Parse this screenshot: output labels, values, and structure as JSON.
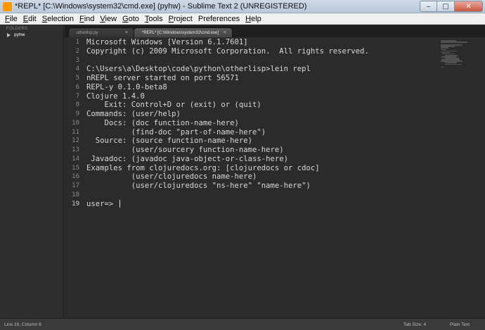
{
  "window": {
    "title": "*REPL* [C:\\Windows\\system32\\cmd.exe] (pyhw) - Sublime Text 2 (UNREGISTERED)",
    "minimize_glyph": "‒",
    "maximize_glyph": "□",
    "close_glyph": "✕"
  },
  "menu": [
    {
      "accel": "F",
      "rest": "ile"
    },
    {
      "accel": "E",
      "rest": "dit"
    },
    {
      "accel": "S",
      "rest": "election"
    },
    {
      "accel": "F",
      "rest": "ind"
    },
    {
      "accel": "V",
      "rest": "iew"
    },
    {
      "accel": "G",
      "rest": "oto"
    },
    {
      "accel": "T",
      "rest": "ools"
    },
    {
      "accel": "P",
      "rest": "roject"
    },
    {
      "accel": "",
      "rest": "Preferences"
    },
    {
      "accel": "H",
      "rest": "elp"
    }
  ],
  "sidebar": {
    "header": "FOLDERS",
    "folder": "pyhw"
  },
  "tabs": [
    {
      "label": "otherlisp.py",
      "close": "×"
    },
    {
      "label": "*REPL* [C:\\Windows\\system32\\cmd.exe]",
      "close": "×"
    }
  ],
  "editor": {
    "current_line": 19,
    "lines": [
      "Microsoft Windows [Version 6.1.7601]",
      "Copyright (c) 2009 Microsoft Corporation.  All rights reserved.",
      "",
      "C:\\Users\\a\\Desktop\\code\\python\\otherlisp>lein repl",
      "nREPL server started on port 56571",
      "REPL-y 0.1.0-beta8",
      "Clojure 1.4.0",
      "    Exit: Control+D or (exit) or (quit)",
      "Commands: (user/help)",
      "    Docs: (doc function-name-here)",
      "          (find-doc \"part-of-name-here\")",
      "  Source: (source function-name-here)",
      "          (user/sourcery function-name-here)",
      " Javadoc: (javadoc java-object-or-class-here)",
      "Examples from clojuredocs.org: [clojuredocs or cdoc]",
      "          (user/clojuredocs name-here)",
      "          (user/clojuredocs \"ns-here\" \"name-here\")",
      "",
      "user=> "
    ]
  },
  "status": {
    "position": "Line 19, Column 8",
    "tab_size": "Tab Size: 4",
    "syntax": "Plain Text"
  }
}
